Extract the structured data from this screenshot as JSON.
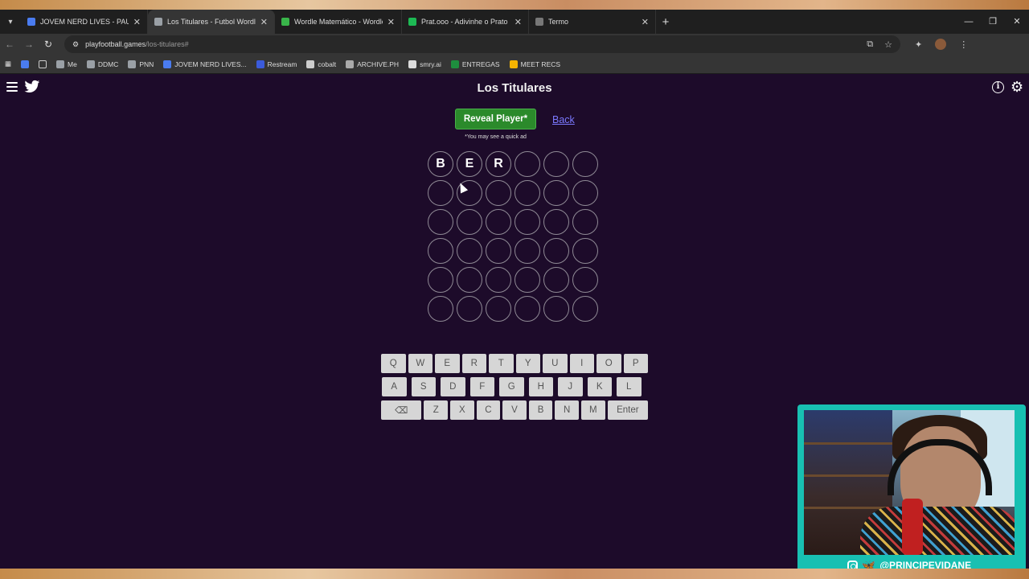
{
  "browser": {
    "tabs": [
      {
        "title": "JOVEM NERD LIVES - PAUTA - D",
        "favicon_color": "#4a7cf0",
        "active": false
      },
      {
        "title": "Los Titulares - Futbol Wordle G",
        "favicon_color": "#9aa0a6",
        "active": true
      },
      {
        "title": "Wordle Matemático - Wordle c",
        "favicon_color": "#39b54a",
        "active": false
      },
      {
        "title": "Prat.ooo - Adivinhe o Prato do",
        "favicon_color": "#1db954",
        "active": false
      },
      {
        "title": "Termo",
        "favicon_color": "#777777",
        "active": false
      }
    ],
    "url_host": "playfootball.games",
    "url_path": "/los-titulares#",
    "bookmarks": [
      {
        "label": "Me",
        "color": "#9aa0a6"
      },
      {
        "label": "DDMC",
        "color": "#9aa0a6"
      },
      {
        "label": "PNN",
        "color": "#9aa0a6"
      },
      {
        "label": "JOVEM NERD LIVES...",
        "color": "#4a7cf0"
      },
      {
        "label": "Restream",
        "color": "#3b5bdb"
      },
      {
        "label": "cobalt",
        "color": "#cccccc"
      },
      {
        "label": "ARCHIVE.PH",
        "color": "#aaaaaa"
      },
      {
        "label": "smry.ai",
        "color": "#dddddd"
      },
      {
        "label": "ENTREGAS",
        "color": "#1e8e3e"
      },
      {
        "label": "MEET RECS",
        "color": "#f4b400"
      }
    ]
  },
  "page": {
    "title": "Los Titulares",
    "reveal_button": "Reveal Player*",
    "back_link": "Back",
    "ad_note": "*You may see a quick ad"
  },
  "grid": {
    "rows": [
      [
        "B",
        "E",
        "R",
        "",
        "",
        ""
      ],
      [
        "",
        "",
        "",
        "",
        "",
        ""
      ],
      [
        "",
        "",
        "",
        "",
        "",
        ""
      ],
      [
        "",
        "",
        "",
        "",
        "",
        ""
      ],
      [
        "",
        "",
        "",
        "",
        "",
        ""
      ],
      [
        "",
        "",
        "",
        "",
        "",
        ""
      ]
    ]
  },
  "keyboard": {
    "row1": [
      "Q",
      "W",
      "E",
      "R",
      "T",
      "Y",
      "U",
      "I",
      "O",
      "P"
    ],
    "row2": [
      "A",
      "S",
      "D",
      "F",
      "G",
      "H",
      "J",
      "K",
      "L"
    ],
    "row3": [
      "⌫",
      "Z",
      "X",
      "C",
      "V",
      "B",
      "N",
      "M",
      "Enter"
    ]
  },
  "stream": {
    "handle": "@PRINCIPEVIDANE",
    "border_color": "#18c0b2"
  }
}
